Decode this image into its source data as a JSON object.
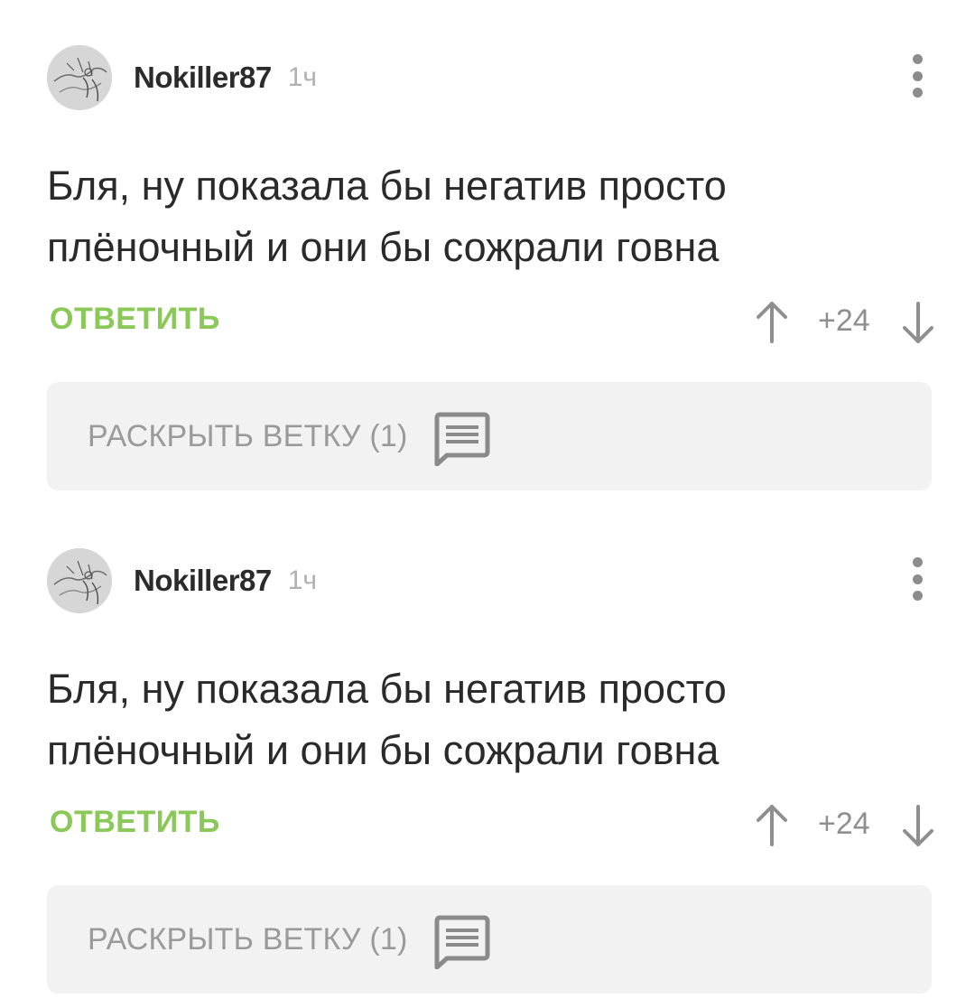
{
  "comments": [
    {
      "username": "Nokiller87",
      "time": "1ч",
      "text": "Бля, ну показала бы негатив просто плёночный и они бы сожрали говна",
      "reply_label": "ОТВЕТИТЬ",
      "rating": "+24",
      "branch_label": "РАСКРЫТЬ ВЕТКУ (1)"
    },
    {
      "username": "Nokiller87",
      "time": "1ч",
      "text": "Бля, ну показала бы негатив просто плёночный и они бы сожрали говна",
      "reply_label": "ОТВЕТИТЬ",
      "rating": "+24",
      "branch_label": "РАСКРЫТЬ ВЕТКУ (1)"
    }
  ],
  "colors": {
    "reply_green": "#8ac858",
    "muted_gray": "#8f8f8f",
    "branch_bg": "#f2f2f2"
  },
  "icons": {
    "menu": "more-vertical-icon",
    "vote_up": "arrow-up-icon",
    "vote_down": "arrow-down-icon",
    "branch": "comment-lines-icon"
  }
}
